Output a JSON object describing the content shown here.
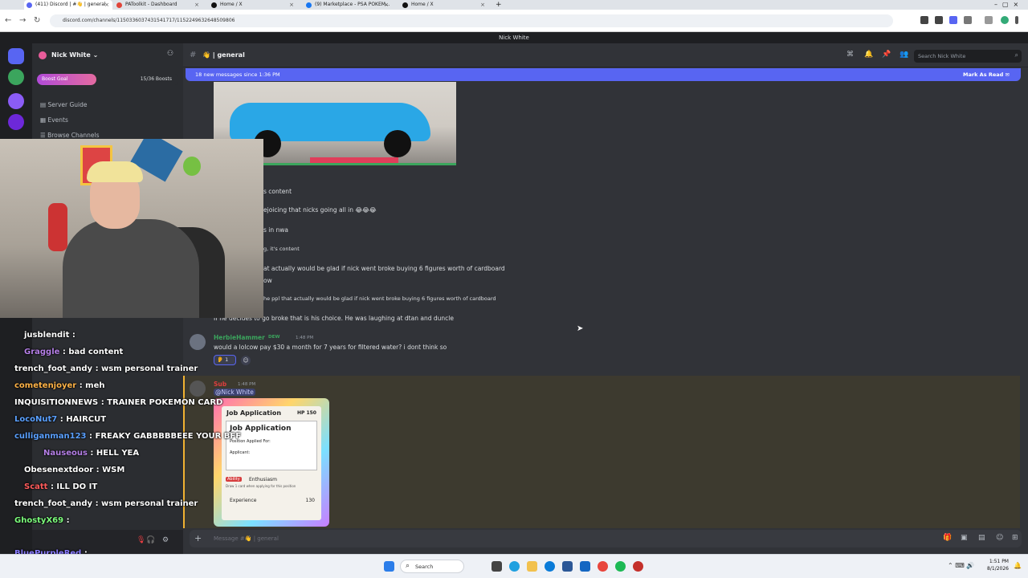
{
  "browser": {
    "tabs": [
      {
        "title": "(411) Discord | #👋 | general"
      },
      {
        "title": "PAToolkit - Dashboard"
      },
      {
        "title": "Home / X"
      },
      {
        "title": "(9) Marketplace - PSA POKEM..."
      },
      {
        "title": "Home / X"
      }
    ],
    "url": "discord.com/channels/1150336037431541717/1152249632648509806"
  },
  "discord": {
    "window_title": "Nick White",
    "server_name": "Nick White",
    "boost_goal_label": "Boost Goal",
    "boost_count": "15/36 Boosts",
    "boost_progress": 0.42,
    "sidebar_items": [
      "Server Guide",
      "Events",
      "Browse Channels"
    ],
    "channel_name": "general",
    "search_placeholder": "Search Nick White",
    "new_messages_text": "18 new messages since 1:36 PM",
    "mark_as_read": "Mark As Read",
    "messages": [
      {
        "text": "s content"
      },
      {
        "text": "ejoicing that nicks going all in 😂😂😂"
      },
      {
        "text": "s in nwa"
      },
      {
        "text": "g, it's content"
      },
      {
        "text": "at actually would be glad if nick went broke buying 6 figures worth of cardboard"
      },
      {
        "text": "ow"
      },
      {
        "text": "he ppl that actually would be glad if nick went broke buying 6 figures worth of cardboard"
      },
      {
        "text": "If he decides to go broke that is his choice. He was laughing at dtan and duncle"
      }
    ],
    "herbie": {
      "username": "HerbieHammer",
      "tag": "DEW",
      "time": "1:48 PM",
      "text": "would a lolcow pay $30 a month for 7 years for filtered water? i dont think so",
      "reaction_count": "1"
    },
    "sub_msg": {
      "username": "Sub",
      "time": "1:48 PM",
      "mention": "@Nick White"
    },
    "card": {
      "title": "Job Application",
      "hp": "HP 150",
      "position_label": "Position Applied For:",
      "applicant_label": "Applicant:",
      "ability": "Ability",
      "ability_name": "Enthusiasm",
      "ability_text": "Draw 1 card when applying for this position",
      "attack": "Experience",
      "damage": "130"
    },
    "message_placeholder": "Message #👋 | general"
  },
  "twitch_chat": [
    {
      "user": "jusblendit",
      "msg": ":",
      "color": "#ffffff"
    },
    {
      "user": "Graggle",
      "msg": ": bad content",
      "color": "#b47fe6"
    },
    {
      "user": "trench_foot_andy",
      "msg": ": wsm personal trainer",
      "color": "#ffffff"
    },
    {
      "user": "cometenjoyer",
      "msg": ": meh",
      "color": "#ffb347"
    },
    {
      "user": "INQUISITIONNEWS",
      "msg": ": TRAINER POKEMON CARD",
      "color": "#ffffff"
    },
    {
      "user": "LocoNut7",
      "msg": ": HAIRCUT",
      "color": "#5aa0ff"
    },
    {
      "user": "culliganman123",
      "msg": ": FREAKY GABBBBBEEE YOUR BFF",
      "color": "#5aa0ff"
    },
    {
      "user": "Nauseous",
      "msg": ": HELL YEA",
      "color": "#b47fe6"
    },
    {
      "user": "Obesenextdoor",
      "msg": ": WSM",
      "color": "#ffffff"
    },
    {
      "user": "Scatt",
      "msg": ": ILL DO IT",
      "color": "#ff5c5c"
    },
    {
      "user": "trench_foot_andy",
      "msg": ": wsm personal trainer",
      "color": "#ffffff"
    },
    {
      "user": "GhostyX69",
      "msg": ":",
      "color": "#7cfc7c"
    },
    {
      "user": "BluePurpleRed",
      "msg": ":",
      "color": "#8a7cff"
    }
  ],
  "taskbar": {
    "search_label": "Search",
    "time": "1:51 PM",
    "date": "8/1/2026"
  }
}
